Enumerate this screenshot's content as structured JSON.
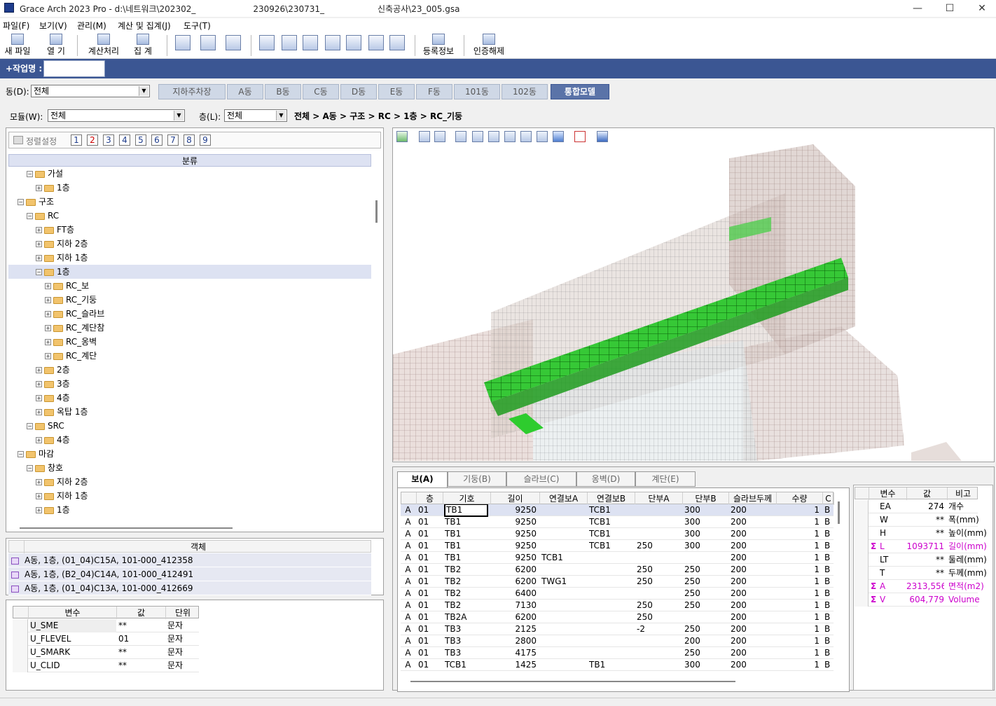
{
  "window": {
    "title": "Grace Arch 2023 Pro - d:\\네트워크\\202302_",
    "title_mid": "230926\\230731_",
    "title_end": "신축공사\\23_005.gsa"
  },
  "menu": [
    "파일(F)",
    "보기(V)",
    "관리(M)",
    "계산 및 집계(J)",
    "도구(T)"
  ],
  "toolbar": {
    "new_file": "새 파일",
    "open": "열  기",
    "calculate": "계산처리",
    "aggregate": "집  계",
    "register": "등록정보",
    "unauth": "인증해제"
  },
  "work": {
    "label": "+작업명 :",
    "value": ""
  },
  "building": {
    "label": "동(D):",
    "value": "전체",
    "tabs": [
      "지하주차장",
      "A동",
      "B동",
      "C동",
      "D동",
      "E동",
      "F동",
      "101동",
      "102동",
      "통합모델"
    ],
    "active": "통합모델"
  },
  "module": {
    "label": "모듈(W):",
    "value": "전체"
  },
  "floor": {
    "label": "층(L):",
    "value": "전체"
  },
  "breadcrumb": "전체 > A동 > 구조 > RC > 1층 > RC_기둥",
  "sort": {
    "label": "정렬설정",
    "levels": [
      "1",
      "2",
      "3",
      "4",
      "5",
      "6",
      "7",
      "8",
      "9"
    ],
    "active": "2"
  },
  "tree": {
    "header": "분류",
    "rows": [
      {
        "label": "가설",
        "level": 3,
        "sign": "⊟",
        "sel": false
      },
      {
        "label": "1층",
        "level": 4,
        "sign": "⊞",
        "sel": false
      },
      {
        "label": "구조",
        "level": 2,
        "sign": "⊟",
        "sel": false
      },
      {
        "label": "RC",
        "level": 3,
        "sign": "⊟",
        "sel": false
      },
      {
        "label": "FT층",
        "level": 4,
        "sign": "⊞",
        "sel": false
      },
      {
        "label": "지하 2층",
        "level": 4,
        "sign": "⊞",
        "sel": false
      },
      {
        "label": "지하 1층",
        "level": 4,
        "sign": "⊞",
        "sel": false
      },
      {
        "label": "1층",
        "level": 4,
        "sign": "⊟",
        "sel": true
      },
      {
        "label": "RC_보",
        "level": 5,
        "sign": "⊞",
        "sel": false
      },
      {
        "label": "RC_기둥",
        "level": 5,
        "sign": "⊞",
        "sel": false
      },
      {
        "label": "RC_슬라브",
        "level": 5,
        "sign": "⊞",
        "sel": false
      },
      {
        "label": "RC_계단참",
        "level": 5,
        "sign": "⊞",
        "sel": false
      },
      {
        "label": "RC_옹벽",
        "level": 5,
        "sign": "⊞",
        "sel": false
      },
      {
        "label": "RC_계단",
        "level": 5,
        "sign": "⊞",
        "sel": false
      },
      {
        "label": "2층",
        "level": 4,
        "sign": "⊞",
        "sel": false
      },
      {
        "label": "3층",
        "level": 4,
        "sign": "⊞",
        "sel": false
      },
      {
        "label": "4층",
        "level": 4,
        "sign": "⊞",
        "sel": false
      },
      {
        "label": "옥탑 1층",
        "level": 4,
        "sign": "⊞",
        "sel": false
      },
      {
        "label": "SRC",
        "level": 3,
        "sign": "⊟",
        "sel": false
      },
      {
        "label": "4층",
        "level": 4,
        "sign": "⊞",
        "sel": false
      },
      {
        "label": "마감",
        "level": 2,
        "sign": "⊟",
        "sel": false
      },
      {
        "label": "창호",
        "level": 3,
        "sign": "⊟",
        "sel": false
      },
      {
        "label": "지하 2층",
        "level": 4,
        "sign": "⊞",
        "sel": false
      },
      {
        "label": "지하 1층",
        "level": 4,
        "sign": "⊞",
        "sel": false
      },
      {
        "label": "1층",
        "level": 4,
        "sign": "⊞",
        "sel": false
      }
    ]
  },
  "objects": {
    "header": "객체",
    "rows": [
      "A동, 1층, (01_04)C15A, 101-000_412358",
      "A동, 1층, (B2_04)C14A, 101-000_412491",
      "A동, 1층, (01_04)C13A, 101-000_412669"
    ]
  },
  "vars_left": {
    "headers": [
      "변수",
      "값",
      "단위"
    ],
    "rows": [
      [
        "U_SME",
        "**",
        "문자"
      ],
      [
        "U_FLEVEL",
        "01",
        "문자"
      ],
      [
        "U_SMARK",
        "**",
        "문자"
      ],
      [
        "U_CLID",
        "**",
        "문자"
      ]
    ]
  },
  "grid_tabs": [
    "보(A)",
    "기둥(B)",
    "슬라브(C)",
    "옹벽(D)",
    "계단(E)"
  ],
  "grid": {
    "headers": [
      "",
      "층",
      "기호",
      "길이",
      "연결보A",
      "연결보B",
      "단부A",
      "단부B",
      "슬라브두께",
      "수량",
      "C"
    ],
    "rows": [
      [
        "A",
        "01",
        "TB1",
        "9250",
        "",
        "TCB1",
        "",
        "300",
        "200",
        "1",
        "B"
      ],
      [
        "A",
        "01",
        "TB1",
        "9250",
        "",
        "TCB1",
        "",
        "300",
        "200",
        "1",
        "B"
      ],
      [
        "A",
        "01",
        "TB1",
        "9250",
        "",
        "TCB1",
        "",
        "300",
        "200",
        "1",
        "B"
      ],
      [
        "A",
        "01",
        "TB1",
        "9250",
        "",
        "TCB1",
        "250",
        "300",
        "200",
        "1",
        "B"
      ],
      [
        "A",
        "01",
        "TB1",
        "9250",
        "TCB1",
        "",
        "",
        "",
        "200",
        "1",
        "B"
      ],
      [
        "A",
        "01",
        "TB2",
        "6200",
        "",
        "",
        "250",
        "250",
        "200",
        "1",
        "B"
      ],
      [
        "A",
        "01",
        "TB2",
        "6200",
        "TWG1",
        "",
        "250",
        "250",
        "200",
        "1",
        "B"
      ],
      [
        "A",
        "01",
        "TB2",
        "6400",
        "",
        "",
        "",
        "250",
        "200",
        "1",
        "B"
      ],
      [
        "A",
        "01",
        "TB2",
        "7130",
        "",
        "",
        "250",
        "250",
        "200",
        "1",
        "B"
      ],
      [
        "A",
        "01",
        "TB2A",
        "6200",
        "",
        "",
        "250",
        "",
        "200",
        "1",
        "B"
      ],
      [
        "A",
        "01",
        "TB3",
        "2125",
        "",
        "",
        "-2",
        "250",
        "200",
        "1",
        "B"
      ],
      [
        "A",
        "01",
        "TB3",
        "2800",
        "",
        "",
        "",
        "200",
        "200",
        "1",
        "B"
      ],
      [
        "A",
        "01",
        "TB3",
        "4175",
        "",
        "",
        "",
        "250",
        "200",
        "1",
        "B"
      ],
      [
        "A",
        "01",
        "TCB1",
        "1425",
        "",
        "TB1",
        "",
        "300",
        "200",
        "1",
        "B"
      ]
    ]
  },
  "summary": {
    "headers": [
      "변수",
      "값",
      "비고"
    ],
    "rows": [
      {
        "sym": "",
        "var": "EA",
        "val": "274",
        "note": "개수",
        "hl": false
      },
      {
        "sym": "",
        "var": "W",
        "val": "**",
        "note": "폭(mm)",
        "hl": false
      },
      {
        "sym": "",
        "var": "H",
        "val": "**",
        "note": "높이(mm)",
        "hl": false
      },
      {
        "sym": "Σ",
        "var": "L",
        "val": "1093711",
        "note": "길이(mm)",
        "hl": true
      },
      {
        "sym": "",
        "var": "LT",
        "val": "**",
        "note": "둘레(mm)",
        "hl": false
      },
      {
        "sym": "",
        "var": "T",
        "val": "**",
        "note": "두께(mm)",
        "hl": false
      },
      {
        "sym": "Σ",
        "var": "A",
        "val": "2313,556",
        "note": "면적(m2)",
        "hl": true
      },
      {
        "sym": "Σ",
        "var": "V",
        "val": "604,779",
        "note": "Volume",
        "hl": true
      }
    ]
  },
  "colors": {
    "accent": "#3b5693",
    "highlight": "#cc00cc",
    "selection": "#dde2f2",
    "model_green": "#2ecc2e"
  }
}
